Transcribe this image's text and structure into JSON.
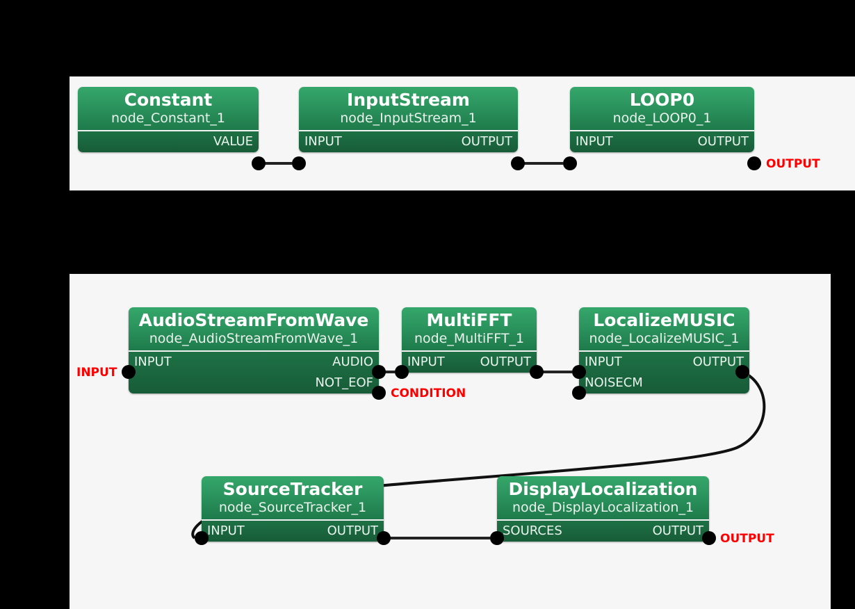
{
  "canvas": {
    "background_color": "#000000",
    "panel_color": "#f6f6f6",
    "node_header_color": "#2d9760",
    "node_port_color": "#1e7145",
    "terminal_color": "#ff0000",
    "edge_color": "#111111"
  },
  "graphs": [
    {
      "id": "main-graph",
      "nodes": [
        {
          "title": "Constant",
          "subtitle": "node_Constant_1",
          "inputs": [],
          "outputs": [
            "VALUE"
          ]
        },
        {
          "title": "InputStream",
          "subtitle": "node_InputStream_1",
          "inputs": [
            "INPUT"
          ],
          "outputs": [
            "OUTPUT"
          ]
        },
        {
          "title": "LOOP0",
          "subtitle": "node_LOOP0_1",
          "inputs": [
            "INPUT"
          ],
          "outputs": [
            "OUTPUT"
          ]
        }
      ],
      "terminals": [
        {
          "label": "OUTPUT",
          "attached_to": "node_LOOP0_1.OUTPUT"
        }
      ],
      "edges": [
        {
          "from": "node_Constant_1.VALUE",
          "to": "node_InputStream_1.INPUT"
        },
        {
          "from": "node_InputStream_1.OUTPUT",
          "to": "node_LOOP0_1.INPUT"
        }
      ]
    },
    {
      "id": "loop0-graph",
      "nodes": [
        {
          "title": "AudioStreamFromWave",
          "subtitle": "node_AudioStreamFromWave_1",
          "inputs": [
            "INPUT"
          ],
          "outputs": [
            "AUDIO",
            "NOT_EOF"
          ]
        },
        {
          "title": "MultiFFT",
          "subtitle": "node_MultiFFT_1",
          "inputs": [
            "INPUT"
          ],
          "outputs": [
            "OUTPUT"
          ]
        },
        {
          "title": "LocalizeMUSIC",
          "subtitle": "node_LocalizeMUSIC_1",
          "inputs": [
            "INPUT",
            "NOISECM"
          ],
          "outputs": [
            "OUTPUT"
          ]
        },
        {
          "title": "SourceTracker",
          "subtitle": "node_SourceTracker_1",
          "inputs": [
            "INPUT"
          ],
          "outputs": [
            "OUTPUT"
          ]
        },
        {
          "title": "DisplayLocalization",
          "subtitle": "node_DisplayLocalization_1",
          "inputs": [
            "SOURCES"
          ],
          "outputs": [
            "OUTPUT"
          ]
        }
      ],
      "terminals": [
        {
          "label": "INPUT",
          "attached_to": "node_AudioStreamFromWave_1.INPUT"
        },
        {
          "label": "CONDITION",
          "attached_to": "node_AudioStreamFromWave_1.NOT_EOF"
        },
        {
          "label": "OUTPUT",
          "attached_to": "node_DisplayLocalization_1.OUTPUT"
        }
      ],
      "edges": [
        {
          "from": "node_AudioStreamFromWave_1.AUDIO",
          "to": "node_MultiFFT_1.INPUT"
        },
        {
          "from": "node_MultiFFT_1.OUTPUT",
          "to": "node_LocalizeMUSIC_1.INPUT"
        },
        {
          "from": "node_LocalizeMUSIC_1.OUTPUT",
          "to": "node_SourceTracker_1.INPUT"
        },
        {
          "from": "node_SourceTracker_1.OUTPUT",
          "to": "node_DisplayLocalization_1.SOURCES"
        }
      ]
    }
  ],
  "labels": {
    "constant_title": "Constant",
    "constant_subtitle": "node_Constant_1",
    "constant_out_value": "VALUE",
    "inputstream_title": "InputStream",
    "inputstream_subtitle": "node_InputStream_1",
    "inputstream_in_input": "INPUT",
    "inputstream_out_output": "OUTPUT",
    "loop0_title": "LOOP0",
    "loop0_subtitle": "node_LOOP0_1",
    "loop0_in_input": "INPUT",
    "loop0_out_output": "OUTPUT",
    "loop0_terminal_output": "OUTPUT",
    "asfw_title": "AudioStreamFromWave",
    "asfw_subtitle": "node_AudioStreamFromWave_1",
    "asfw_in_input": "INPUT",
    "asfw_out_audio": "AUDIO",
    "asfw_out_noteof": "NOT_EOF",
    "asfw_terminal_input": "INPUT",
    "asfw_terminal_condition": "CONDITION",
    "multifft_title": "MultiFFT",
    "multifft_subtitle": "node_MultiFFT_1",
    "multifft_in_input": "INPUT",
    "multifft_out_output": "OUTPUT",
    "music_title": "LocalizeMUSIC",
    "music_subtitle": "node_LocalizeMUSIC_1",
    "music_in_input": "INPUT",
    "music_in_noisecm": "NOISECM",
    "music_out_output": "OUTPUT",
    "tracker_title": "SourceTracker",
    "tracker_subtitle": "node_SourceTracker_1",
    "tracker_in_input": "INPUT",
    "tracker_out_output": "OUTPUT",
    "display_title": "DisplayLocalization",
    "display_subtitle": "node_DisplayLocalization_1",
    "display_in_sources": "SOURCES",
    "display_out_output": "OUTPUT",
    "display_terminal_output": "OUTPUT"
  }
}
